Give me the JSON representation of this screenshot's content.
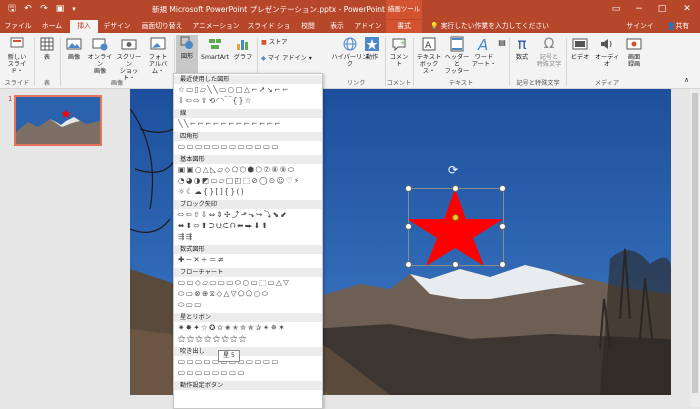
{
  "title_bar": {
    "title": "新規 Microsoft PowerPoint プレゼンテーション.pptx - PowerPoint",
    "contextual_tool": "描画ツール",
    "signin": "サインイン",
    "share": "共有"
  },
  "tabs": {
    "file": "ファイル",
    "home": "ホーム",
    "insert": "挿入",
    "design": "デザイン",
    "transitions": "画面切り替え",
    "animations": "アニメーション",
    "slideshow": "スライド ショー",
    "review": "校閲",
    "view": "表示",
    "addins": "アドイン",
    "format": "書式",
    "tell_me": "実行したい作業を入力してください"
  },
  "ribbon": {
    "new_slide": "新しい",
    "new_slide2": "スライド・",
    "table": "表",
    "image": "画像",
    "online_image": "オンライン",
    "online_image2": "画像",
    "screenshot": "スクリーン",
    "screenshot2": "ショット・",
    "photo_album": "フォト",
    "photo_album2": "アルバム・",
    "shapes": "図形",
    "smartart": "SmartArt",
    "graph": "グラフ",
    "store": "ストア",
    "my_addins": "マイ アドイン",
    "hyperlink": "ハイパーリンク",
    "action": "動作",
    "comment": "コメント",
    "textbox": "テキスト",
    "textbox2": "ボックス・",
    "header_footer": "ヘッダーと",
    "header_footer2": "フッター",
    "wordart": "ワード",
    "wordart2": "アート・",
    "equation": "数式",
    "symbol": "記号と",
    "symbol2": "特殊文字",
    "video": "ビデオ",
    "audio": "オーディオ",
    "screen_record": "画面",
    "screen_record2": "録画",
    "groups": {
      "slide": "スライド",
      "table": "表",
      "image": "画像",
      "link": "リンク",
      "comment": "コメント",
      "text": "テキスト",
      "symbols": "記号と特殊文字",
      "media": "メディア"
    }
  },
  "thumbnail": {
    "number": "1"
  },
  "shapes_menu": {
    "sections": [
      {
        "title": "最近使用した図形",
        "rows": [
          "☆▭▯▱╲╲▭○▢△⌐↗↘⌐⌐",
          "⇩⇦⇨⇧⟲◜◝⁀{}☆"
        ]
      },
      {
        "title": "線",
        "rows": [
          "╲╲⌐⌐⌐⌐⌐⌐⌐⌐⌐⌐⌐⌐"
        ]
      },
      {
        "title": "四角形",
        "rows": [
          "▭▭▭▭▭▭▭▭▭▭▭▭"
        ]
      },
      {
        "title": "基本図形",
        "rows": [
          "▣▣○△◺▱◇⬠⬡⬢⬡⑦⑧⑨⬭",
          "◔◕◑◩▭▱□◰⬚⊘◯⊙☺♡⚡",
          "☼☾☁{}[]{}()"
        ]
      },
      {
        "title": "ブロック矢印",
        "rows": [
          "⇨⇦⇧⇩⇔⇕✣⤴⬏⬎↪⤵⬊⬋",
          "⬌⬍⬄⬆⮊⮋⮈⮉⬅⮕⬇⬆",
          "⇶⇶"
        ]
      },
      {
        "title": "数式図形",
        "rows": [
          "✚−✕÷＝≠"
        ]
      },
      {
        "title": "フローチャート",
        "rows": [
          "▭▭◇▱▭▭▭⬭○▭⬚▭△▽",
          "⬭▭⊗⊕⧖◇△▽⬠⬠○⬭",
          "⬭▭▭"
        ]
      },
      {
        "title": "星とリボン",
        "rows": [
          "✷✸✦☆✪✫✬✭✮✯✰✴✵✶",
          "⚝⚝⚝⚝⚝⚝⚝⚝"
        ]
      },
      {
        "title": "吹き出し",
        "rows": [
          "▭▭▭▭▭▭▭▭▭▭▭▭",
          "▭▭▭▭▭▭▭▭"
        ]
      },
      {
        "title": "動作設定ボタン",
        "rows": []
      }
    ],
    "tooltip": "星 5"
  },
  "colors": {
    "accent": "#b7472a",
    "star": "#ff0000"
  }
}
